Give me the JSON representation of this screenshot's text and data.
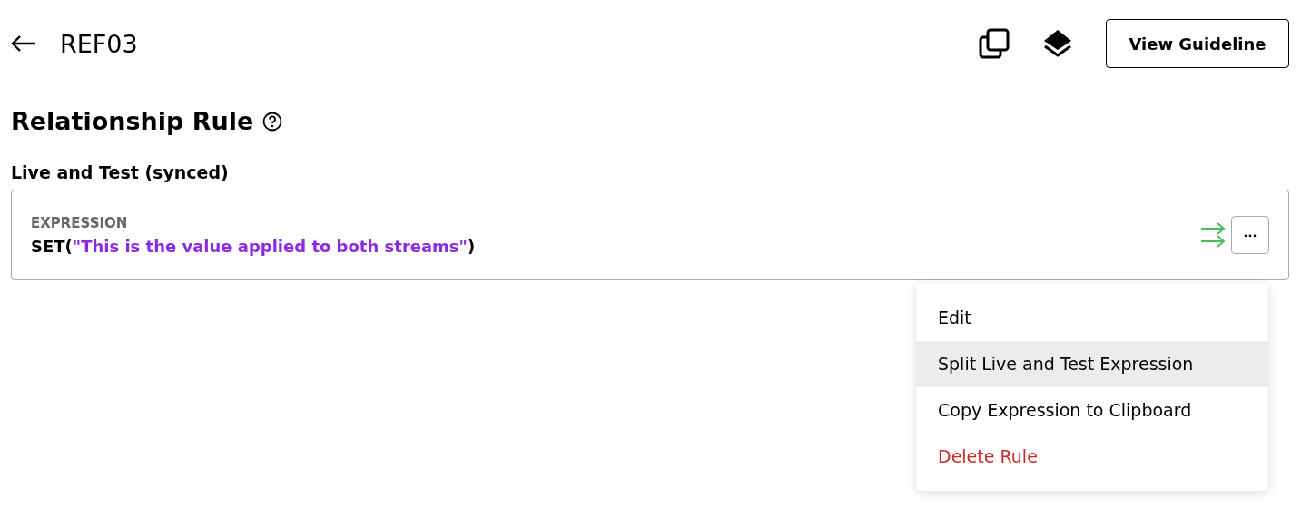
{
  "header": {
    "title": "REF03",
    "button": "View Guideline"
  },
  "section": {
    "title": "Relationship Rule",
    "label": "Live and Test (synced)"
  },
  "rule": {
    "caption": "EXPRESSION",
    "expression": {
      "function": "SET(",
      "argument": "\"This is the value applied to both streams\"",
      "close": ")"
    },
    "menu_button": "···"
  },
  "menu": [
    {
      "label": "Edit",
      "kind": "normal",
      "selected": false
    },
    {
      "label": "Split Live and Test Expression",
      "kind": "normal",
      "selected": true
    },
    {
      "label": "Copy Expression to Clipboard",
      "kind": "normal",
      "selected": false
    },
    {
      "label": "Delete Rule",
      "kind": "danger",
      "selected": false
    }
  ]
}
